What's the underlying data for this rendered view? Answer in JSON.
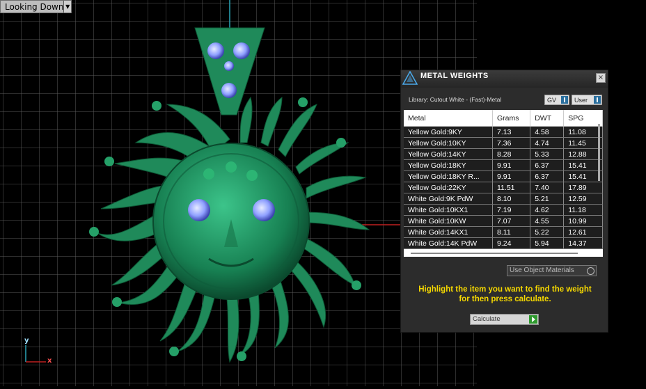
{
  "viewport": {
    "view_label": "Looking Down",
    "axis_y": "y",
    "axis_x": "x"
  },
  "panel": {
    "title": "METAL WEIGHTS",
    "close": "×",
    "library": "Library: Cutout White - (Fast)-Metal",
    "gv_label": "GV",
    "user_label": "User",
    "columns": [
      "Metal",
      "Grams",
      "DWT",
      "SPG"
    ],
    "rows": [
      [
        "Yellow Gold:9KY",
        "7.13",
        "4.58",
        "11.08"
      ],
      [
        "Yellow Gold:10KY",
        "7.36",
        "4.74",
        "11.45"
      ],
      [
        "Yellow Gold:14KY",
        "8.28",
        "5.33",
        "12.88"
      ],
      [
        "Yellow Gold:18KY",
        "9.91",
        "6.37",
        "15.41"
      ],
      [
        "Yellow Gold:18KY R...",
        "9.91",
        "6.37",
        "15.41"
      ],
      [
        "Yellow Gold:22KY",
        "11.51",
        "7.40",
        "17.89"
      ],
      [
        "White Gold:9K PdW",
        "8.10",
        "5.21",
        "12.59"
      ],
      [
        "White Gold:10KX1",
        "7.19",
        "4.62",
        "11.18"
      ],
      [
        "White Gold:10KW",
        "7.07",
        "4.55",
        "10.99"
      ],
      [
        "White Gold:14KX1",
        "8.11",
        "5.22",
        "12.61"
      ],
      [
        "White Gold:14K PdW",
        "9.24",
        "5.94",
        "14.37"
      ]
    ],
    "use_materials": "Use Object Materials",
    "instruction_line1": "Highlight the item you want to find the weight",
    "instruction_line2": "for then press calculate.",
    "calculate_label": "Calculate"
  },
  "colors": {
    "grid": "#5a5a5a",
    "pendant": "#1f8a5a",
    "gem": "#8fa0ff",
    "instruction": "#f5d800"
  },
  "icons": [
    "chevron-down-icon",
    "close-icon",
    "app-logo-icon",
    "toggle-indicator-icon",
    "play-arrow-icon"
  ]
}
